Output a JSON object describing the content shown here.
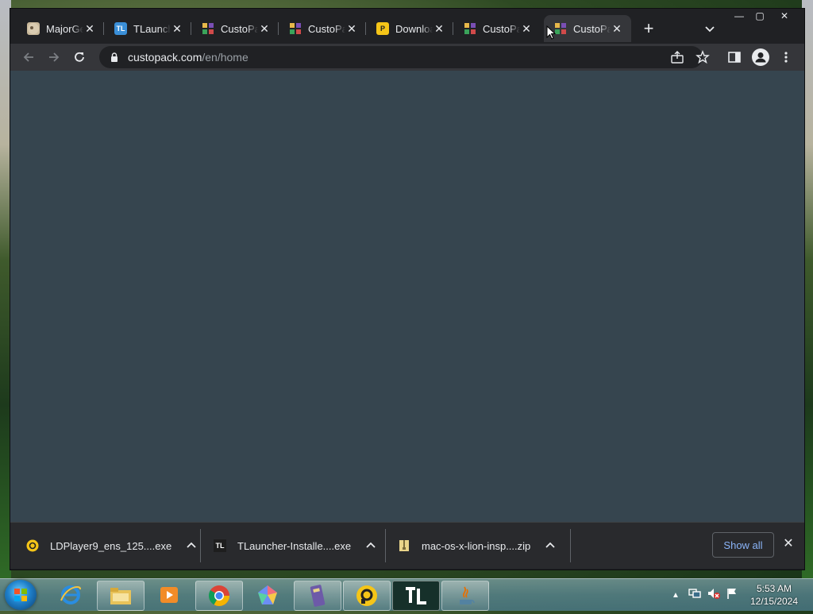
{
  "browser": {
    "tabs": [
      {
        "title": "MajorGeeks",
        "icon": "majorgeeks-favicon",
        "active": false
      },
      {
        "title": "TLauncher",
        "icon": "tlauncher-favicon",
        "active": false
      },
      {
        "title": "CustoPack",
        "icon": "custopack-favicon",
        "active": false
      },
      {
        "title": "CustoPack",
        "icon": "custopack-favicon",
        "active": false
      },
      {
        "title": "Download",
        "icon": "ldplayer-favicon",
        "active": false
      },
      {
        "title": "CustoPack",
        "icon": "custopack-favicon",
        "active": false
      },
      {
        "title": "CustoPack",
        "icon": "custopack-favicon",
        "active": true
      }
    ],
    "window_controls": {
      "minimize": "—",
      "maximize": "▢",
      "close": "✕"
    },
    "toolbar": {
      "url_host": "custopack.com",
      "url_path": "/en/home"
    },
    "downloads": [
      {
        "filename": "LDPlayer9_ens_125....exe",
        "icon": "ldplayer-icon"
      },
      {
        "filename": "TLauncher-Installe....exe",
        "icon": "tlauncher-icon"
      },
      {
        "filename": "mac-os-x-lion-insp....zip",
        "icon": "zip-archive-icon"
      }
    ],
    "show_all_label": "Show all",
    "page_background": "#36454f"
  },
  "taskbar": {
    "pinned": [
      "internet-explorer",
      "file-explorer",
      "media-player",
      "chrome",
      "app-launcher",
      "winrar",
      "ldplayer",
      "tlauncher",
      "java"
    ],
    "clock_time": "5:53 AM",
    "clock_date": "12/15/2024"
  }
}
